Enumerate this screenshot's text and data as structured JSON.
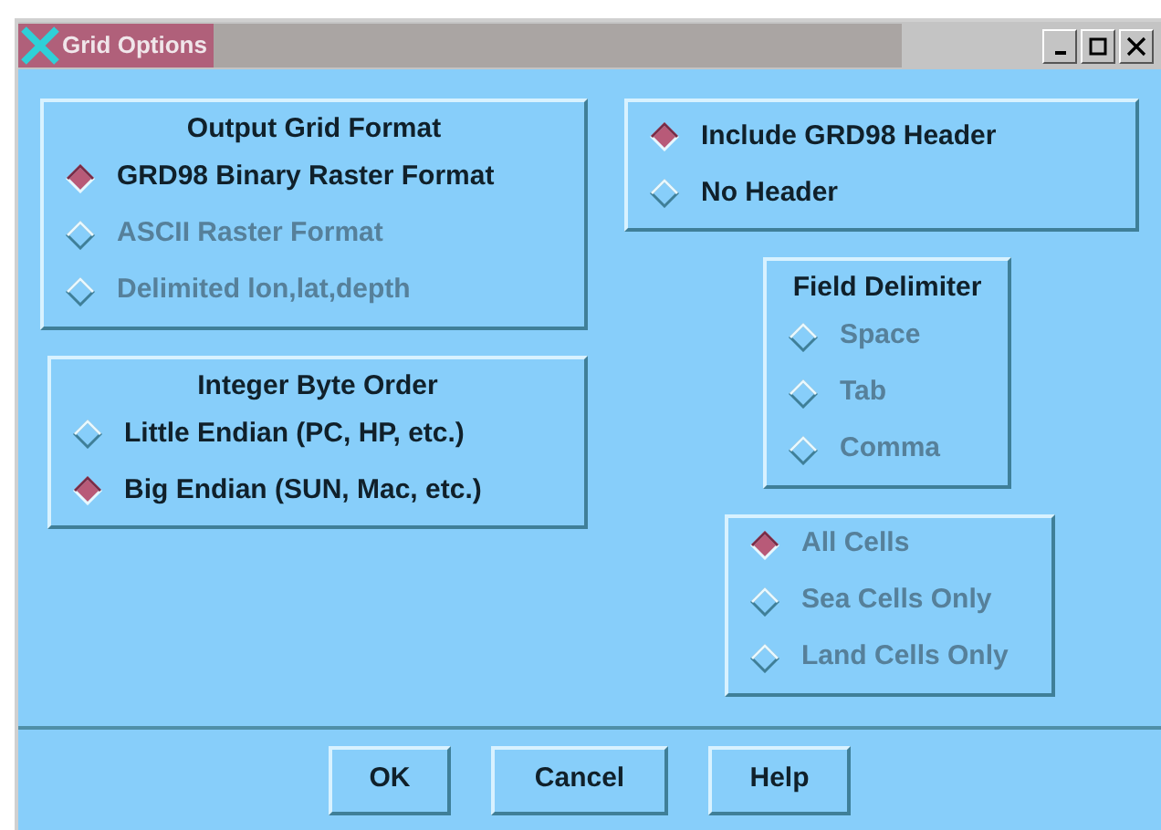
{
  "window": {
    "title": "Grid Options"
  },
  "left_groups": [
    {
      "title": "Output Grid Format",
      "options": [
        {
          "label": "GRD98 Binary Raster Format",
          "selected": true,
          "disabled": false
        },
        {
          "label": "ASCII Raster Format",
          "selected": false,
          "disabled": true
        },
        {
          "label": "Delimited lon,lat,depth",
          "selected": false,
          "disabled": true
        }
      ]
    },
    {
      "title": "Integer Byte Order",
      "options": [
        {
          "label": "Little Endian (PC, HP, etc.)",
          "selected": false,
          "disabled": false
        },
        {
          "label": "Big Endian (SUN, Mac, etc.)",
          "selected": true,
          "disabled": false
        }
      ]
    }
  ],
  "right_groups": [
    {
      "options": [
        {
          "label": "Include GRD98 Header",
          "selected": true,
          "disabled": false
        },
        {
          "label": "No Header",
          "selected": false,
          "disabled": false
        }
      ]
    },
    {
      "title": "Field Delimiter",
      "options": [
        {
          "label": "Space",
          "selected": false,
          "disabled": true
        },
        {
          "label": "Tab",
          "selected": false,
          "disabled": true
        },
        {
          "label": "Comma",
          "selected": false,
          "disabled": true
        }
      ]
    },
    {
      "options": [
        {
          "label": "All Cells",
          "selected": true,
          "disabled": true
        },
        {
          "label": "Sea Cells Only",
          "selected": false,
          "disabled": true
        },
        {
          "label": "Land Cells Only",
          "selected": false,
          "disabled": true
        }
      ]
    }
  ],
  "buttons": [
    "OK",
    "Cancel",
    "Help"
  ]
}
